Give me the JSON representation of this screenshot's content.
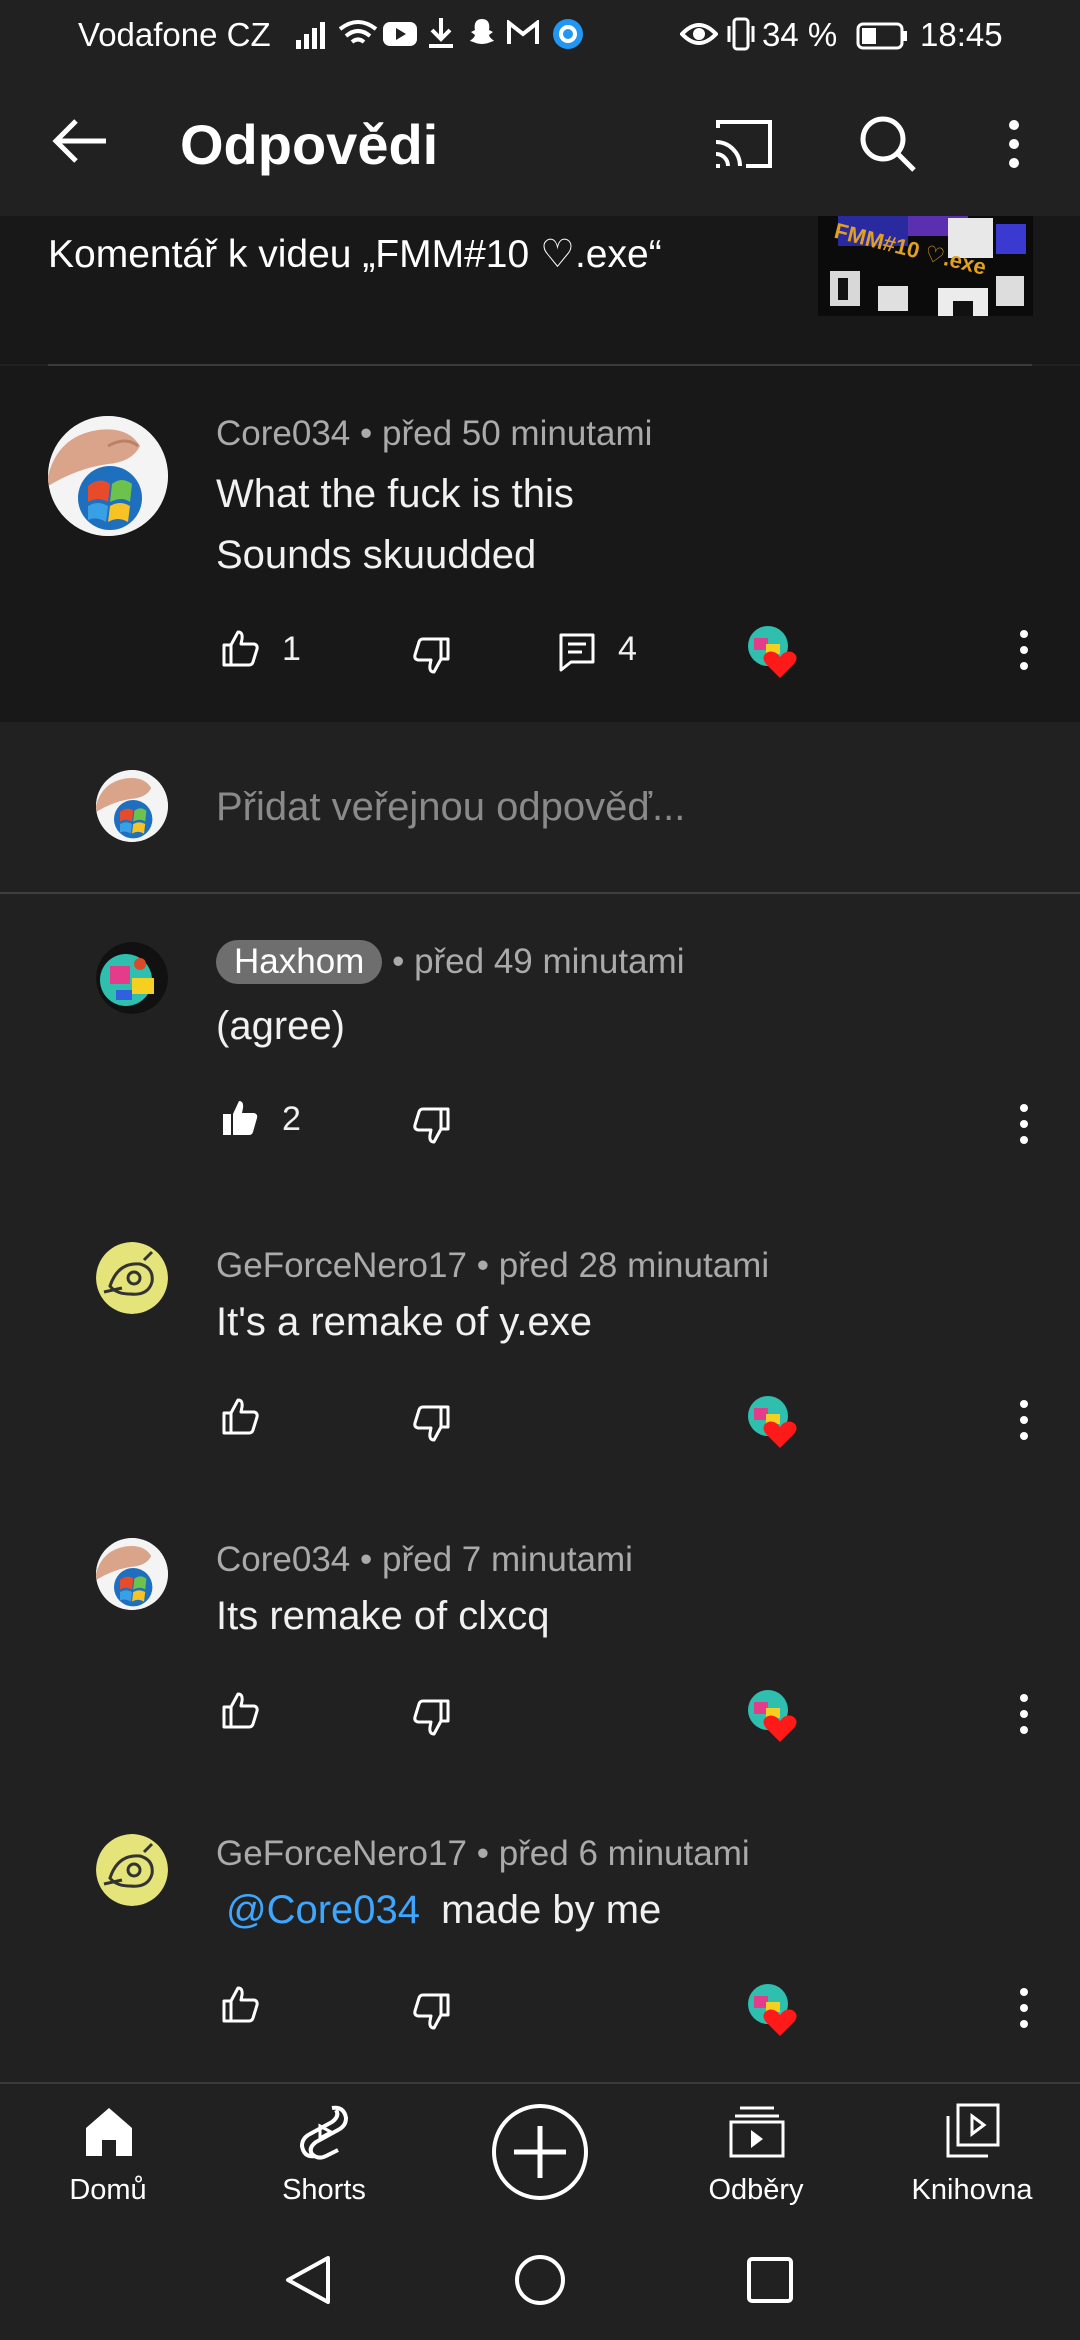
{
  "status_bar": {
    "carrier": "Vodafone CZ",
    "battery": "34 %",
    "time": "18:45"
  },
  "app_bar": {
    "title": "Odpovědi"
  },
  "video_context": {
    "text": "Komentář k videu „FMM#10 ♡.exe“",
    "thumbnail_caption": "FMM#10 ♡.exe"
  },
  "parent_comment": {
    "author": "Core034",
    "time": "před 50 minutami",
    "lines": [
      "What the fuck is this",
      "Sounds skuudded"
    ],
    "likes": "1",
    "replies": "4"
  },
  "reply_input": {
    "placeholder": "Přidat veřejnou odpověď..."
  },
  "replies": [
    {
      "author": "Haxhom",
      "time": "před 49 minutami",
      "text": "(agree)",
      "likes": "2"
    },
    {
      "author": "GeForceNero17",
      "time": "před 28 minutami",
      "text": "It's a remake of y.exe"
    },
    {
      "author": "Core034",
      "time": "před 7 minutami",
      "text": "Its remake of clxcq"
    },
    {
      "author": "GeForceNero17",
      "time": "před 6 minutami",
      "mention": "@Core034",
      "text": "made by me"
    }
  ],
  "bottom_nav": {
    "home": "Domů",
    "shorts": "Shorts",
    "subscriptions": "Odběry",
    "library": "Knihovna"
  },
  "colors": {
    "background": "#212121",
    "mention": "#3ea6ff",
    "heart": "#ff1a1a"
  }
}
